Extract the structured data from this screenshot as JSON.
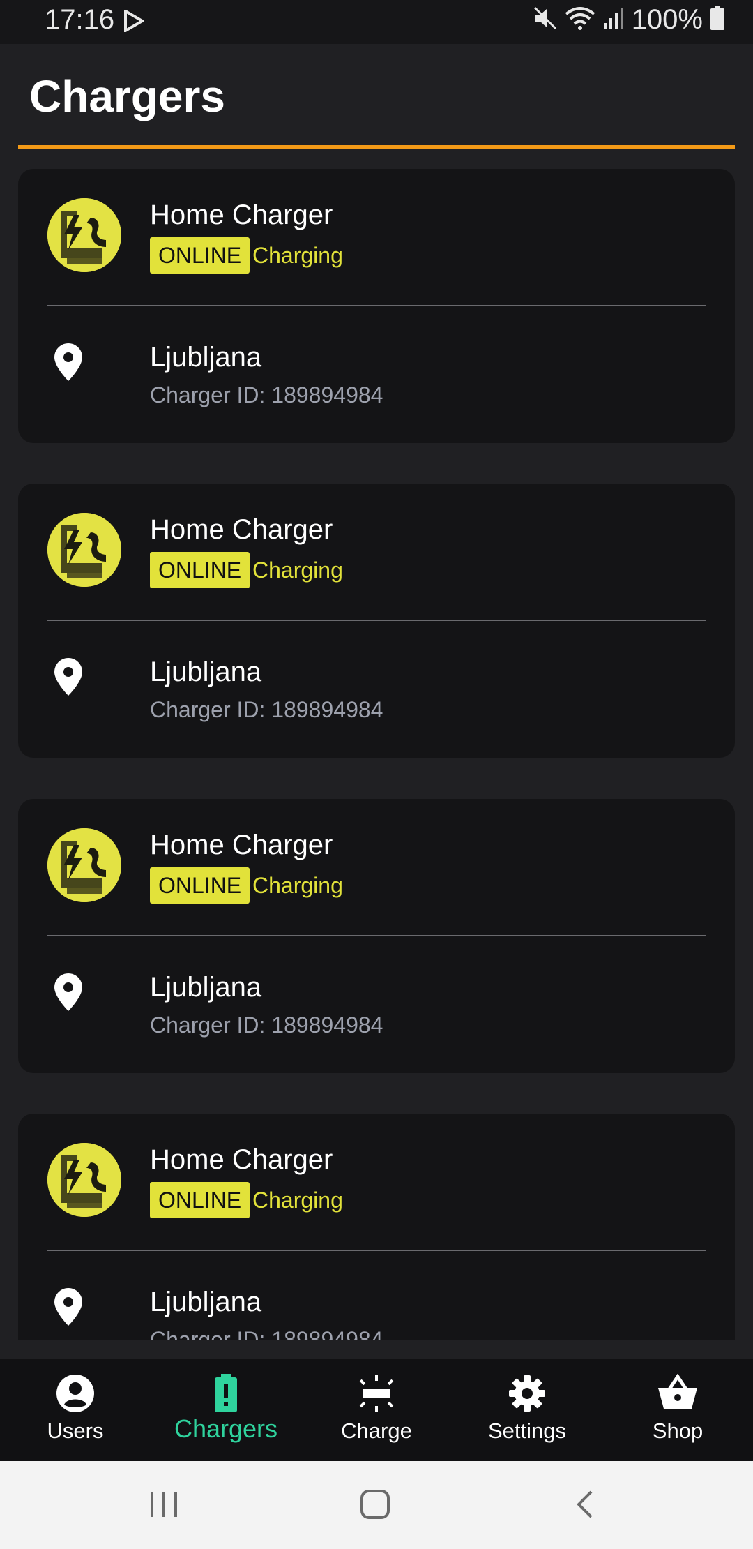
{
  "status_bar": {
    "time": "17:16",
    "battery_text": "100%",
    "icons": [
      "play-store-icon",
      "mute-icon",
      "wifi-icon",
      "signal-icon",
      "battery-icon"
    ]
  },
  "header": {
    "title": "Chargers",
    "accent_color": "#f39a17"
  },
  "chargers": [
    {
      "name": "Home Charger",
      "badge": "ONLINE",
      "status": "Charging",
      "location": "Ljubljana",
      "charger_id": "Charger ID: 189894984"
    },
    {
      "name": "Home Charger",
      "badge": "ONLINE",
      "status": "Charging",
      "location": "Ljubljana",
      "charger_id": "Charger ID: 189894984"
    },
    {
      "name": "Home Charger",
      "badge": "ONLINE",
      "status": "Charging",
      "location": "Ljubljana",
      "charger_id": "Charger ID: 189894984"
    },
    {
      "name": "Home Charger",
      "badge": "ONLINE",
      "status": "Charging",
      "location": "Ljubljana",
      "charger_id": "Charger ID: 189894984"
    }
  ],
  "bottom_nav": {
    "items": [
      {
        "label": "Users",
        "icon": "account-circle-icon"
      },
      {
        "label": "Chargers",
        "icon": "battery-alert-icon",
        "active": true
      },
      {
        "label": "Charge",
        "icon": "charge-icon"
      },
      {
        "label": "Settings",
        "icon": "gear-icon"
      },
      {
        "label": "Shop",
        "icon": "shopping-basket-icon"
      }
    ],
    "active_color": "#2fd39d"
  },
  "colors": {
    "badge_bg": "#e2e23a",
    "card_bg": "#141416",
    "page_bg": "#202023"
  }
}
